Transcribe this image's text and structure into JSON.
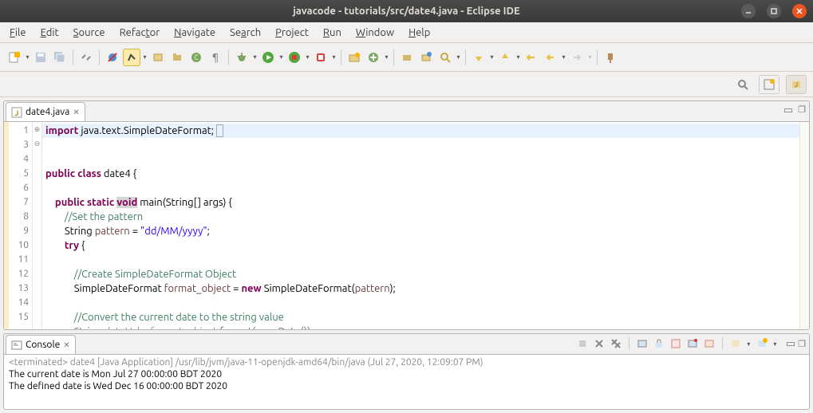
{
  "title": "javacode - tutorials/src/date4.java - Eclipse IDE",
  "menu": [
    "File",
    "Edit",
    "Source",
    "Refactor",
    "Navigate",
    "Search",
    "Project",
    "Run",
    "Window",
    "Help"
  ],
  "menu_accel": [
    0,
    0,
    0,
    5,
    0,
    2,
    0,
    0,
    0,
    0
  ],
  "tab": {
    "label": "date4.java",
    "close": "✕"
  },
  "code": {
    "lines": [
      1,
      3,
      4,
      5,
      6,
      7,
      8,
      9,
      10,
      11,
      12,
      13,
      14,
      15
    ],
    "l1a": "import",
    "l1b": " java.text.SimpleDateFormat;",
    "l4a": "public",
    "l4b": "class",
    "l4c": " date4 {",
    "l6a": "public",
    "l6b": "static",
    "l6c": "void",
    "l6d": " main(String[] args) {",
    "l7": "//Set the pattern",
    "l8a": "String ",
    "l8b": "pattern",
    "l8c": " = ",
    "l8d": "\"dd/MM/yyyy\"",
    "l8e": ";",
    "l9a": "try",
    "l9b": " {",
    "l11": "//Create SimpleDateFormat Object",
    "l12a": "SimpleDateFormat ",
    "l12b": "format_object",
    "l12c": " = ",
    "l12d": "new",
    "l12e": " SimpleDateFormat(",
    "l12f": "pattern",
    "l12g": ");",
    "l14": "//Convert the current date to the string value",
    "l15a": "String ",
    "l15b": "dateVal",
    "l15c": " = ",
    "l15d": "format_object",
    "l15e": ".format(",
    "l15f": "new",
    "l15g": " Date());"
  },
  "console": {
    "tab": "Console",
    "term": "<terminated> date4 [Java Application] /usr/lib/jvm/java-11-openjdk-amd64/bin/java (Jul 27, 2020, 12:09:07 PM)",
    "out1": "The current date is Mon Jul 27 00:00:00 BDT 2020",
    "out2": "The defined date is Wed Dec 16 00:00:00 BDT 2020"
  }
}
